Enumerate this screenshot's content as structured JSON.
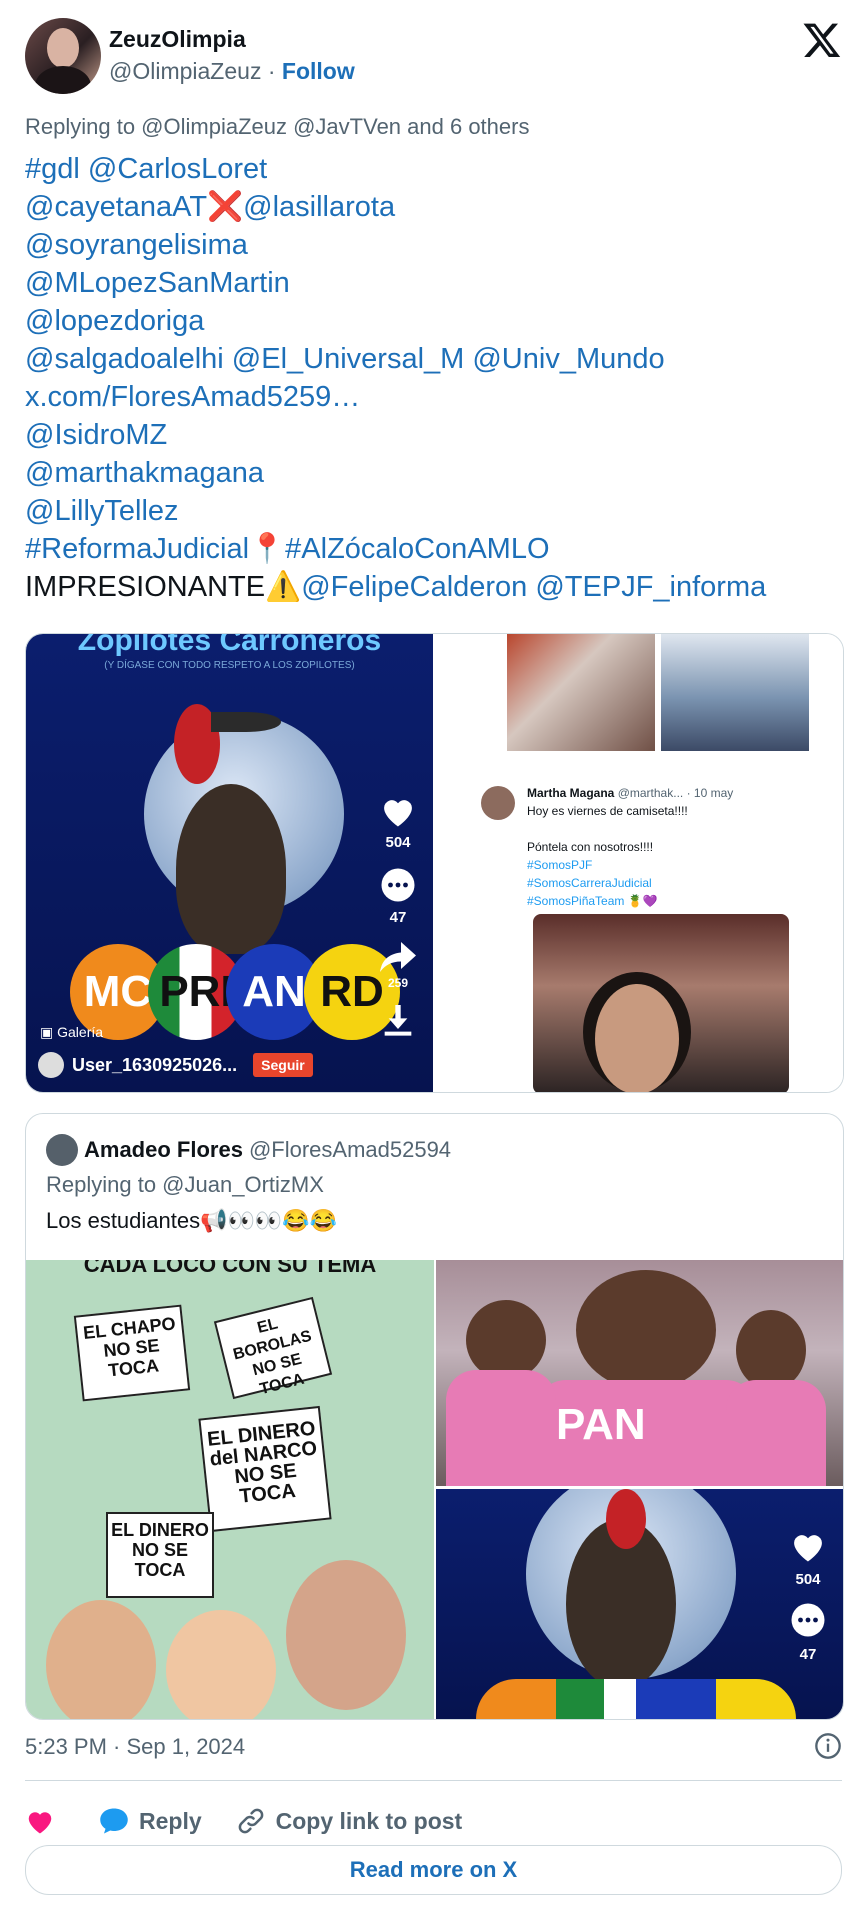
{
  "author": {
    "name": "ZeuzOlimpia",
    "handle": "@OlimpiaZeuz",
    "separator": "·",
    "follow_label": "Follow"
  },
  "reply_context": "Replying to @OlimpiaZeuz @JavTVen and 6 others",
  "tweet_lines": {
    "l1": "#gdl @CarlosLoret",
    "l2a": "@cayetanaAT",
    "l2x": "❌",
    "l2b": "@lasillarota",
    "l3": "@soyrangelisima",
    "l4": "@MLopezSanMartin",
    "l5": "@lopezdoriga",
    "l6": "@salgadoalelhi @El_Universal_M @Univ_Mundo",
    "l7": "x.com/FloresAmad5259…",
    "l8": "@IsidroMZ",
    "l9": "@marthakmagana",
    "l10": "@LillyTellez",
    "l11a": "#ReformaJudicial",
    "l11pin": "📍",
    "l11b": "#AlZócaloConAMLO",
    "l12a": "IMPRESIONANTE",
    "l12warn": "⚠️",
    "l12b": "@FelipeCalderon @TEPJF_informa"
  },
  "media1": {
    "left": {
      "title": "Zopilotes Carroñeros",
      "subtitle": "(Y DÍGASE CON TODO RESPETO A LOS ZOPILOTES)",
      "balls": [
        "MC",
        "PRI",
        "AN",
        "RD"
      ],
      "likes": "504",
      "comments": "47",
      "shares": "259",
      "gallery_label": "Galería",
      "user": "User_1630925026...",
      "follow_btn": "Seguir"
    },
    "right": {
      "card_name": "Martha Magana",
      "card_handle": "@marthak...",
      "card_date": "· 10 may",
      "card_text1": "Hoy es viernes de camiseta!!!!",
      "card_text2": "Póntela con nosotros!!!!",
      "tags": [
        "#SomosPJF",
        "#SomosCarreraJudicial",
        "#SomosPiñaTeam 🍍💜"
      ]
    }
  },
  "quote": {
    "name": "Amadeo Flores",
    "handle": "@FloresAmad52594",
    "replying": "Replying to @Juan_OrtizMX",
    "text": "Los estudiantes📢👀👀😂😂",
    "cartoon_title": "CADA LOCO CON SU TEMA",
    "signs": [
      "EL CHAPO NO SE TOCA",
      "EL BOROLAS NO SE TOCA",
      "EL DINERO del NARCO NO SE TOCA",
      "EL DINERO NO SE TOCA"
    ],
    "pan_label": "PAN",
    "likes": "504",
    "comments": "47"
  },
  "timestamp": "5:23 PM · Sep 1, 2024",
  "actions": {
    "reply": "Reply",
    "copy": "Copy link to post"
  },
  "read_more": "Read more on X",
  "colors": {
    "link": "#1d6fb8",
    "muted": "#536471",
    "like": "#f91880",
    "reply_icon": "#1d9bf0"
  }
}
